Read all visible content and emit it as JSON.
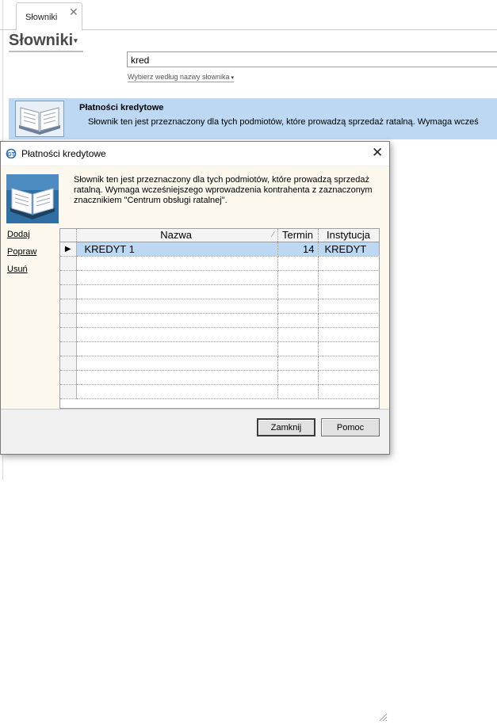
{
  "tab": {
    "label": "Słowniki",
    "close": "✕"
  },
  "page": {
    "title": "Słowniki",
    "title_caret": "▾"
  },
  "search": {
    "value": "kred",
    "mode_label": "Wybierz według nazwy słownika",
    "mode_caret": "▾"
  },
  "result": {
    "icon": "dictionary-book-icon",
    "title": "Płatności kredytowe",
    "description": "Słownik ten jest przeznaczony dla tych podmiotów, które prowadzą sprzedaż ratalną. Wymaga wcześ"
  },
  "dialog": {
    "app_icon": "gt-app-icon",
    "title": "Płatności kredytowe",
    "close": "✕",
    "icon": "dictionary-book-icon",
    "description": "Słownik ten jest przeznaczony dla tych podmiotów, które prowadzą sprzedaż ratalną. Wymaga wcześniejszego wprowadzenia kontrahenta z zaznaczonym znacznikiem \"Centrum obsługi ratalnej\".",
    "actions": {
      "add": "Dodaj",
      "edit": "Popraw",
      "delete": "Usuń"
    },
    "grid": {
      "columns": [
        "Nazwa",
        "Termin",
        "Instytucja"
      ],
      "sort_glyph": "⁄",
      "rows": [
        {
          "indicator": "▶",
          "name": "KREDYT 1",
          "term": "14",
          "institution": "KREDYT"
        }
      ],
      "empty_rows": 10
    },
    "buttons": {
      "close": "Zamknij",
      "help": "Pomoc"
    }
  },
  "colors": {
    "selection": "#bcd8f2",
    "dialog_body": "#fdf8ee",
    "dialog_chrome": "#f0f0f0"
  }
}
